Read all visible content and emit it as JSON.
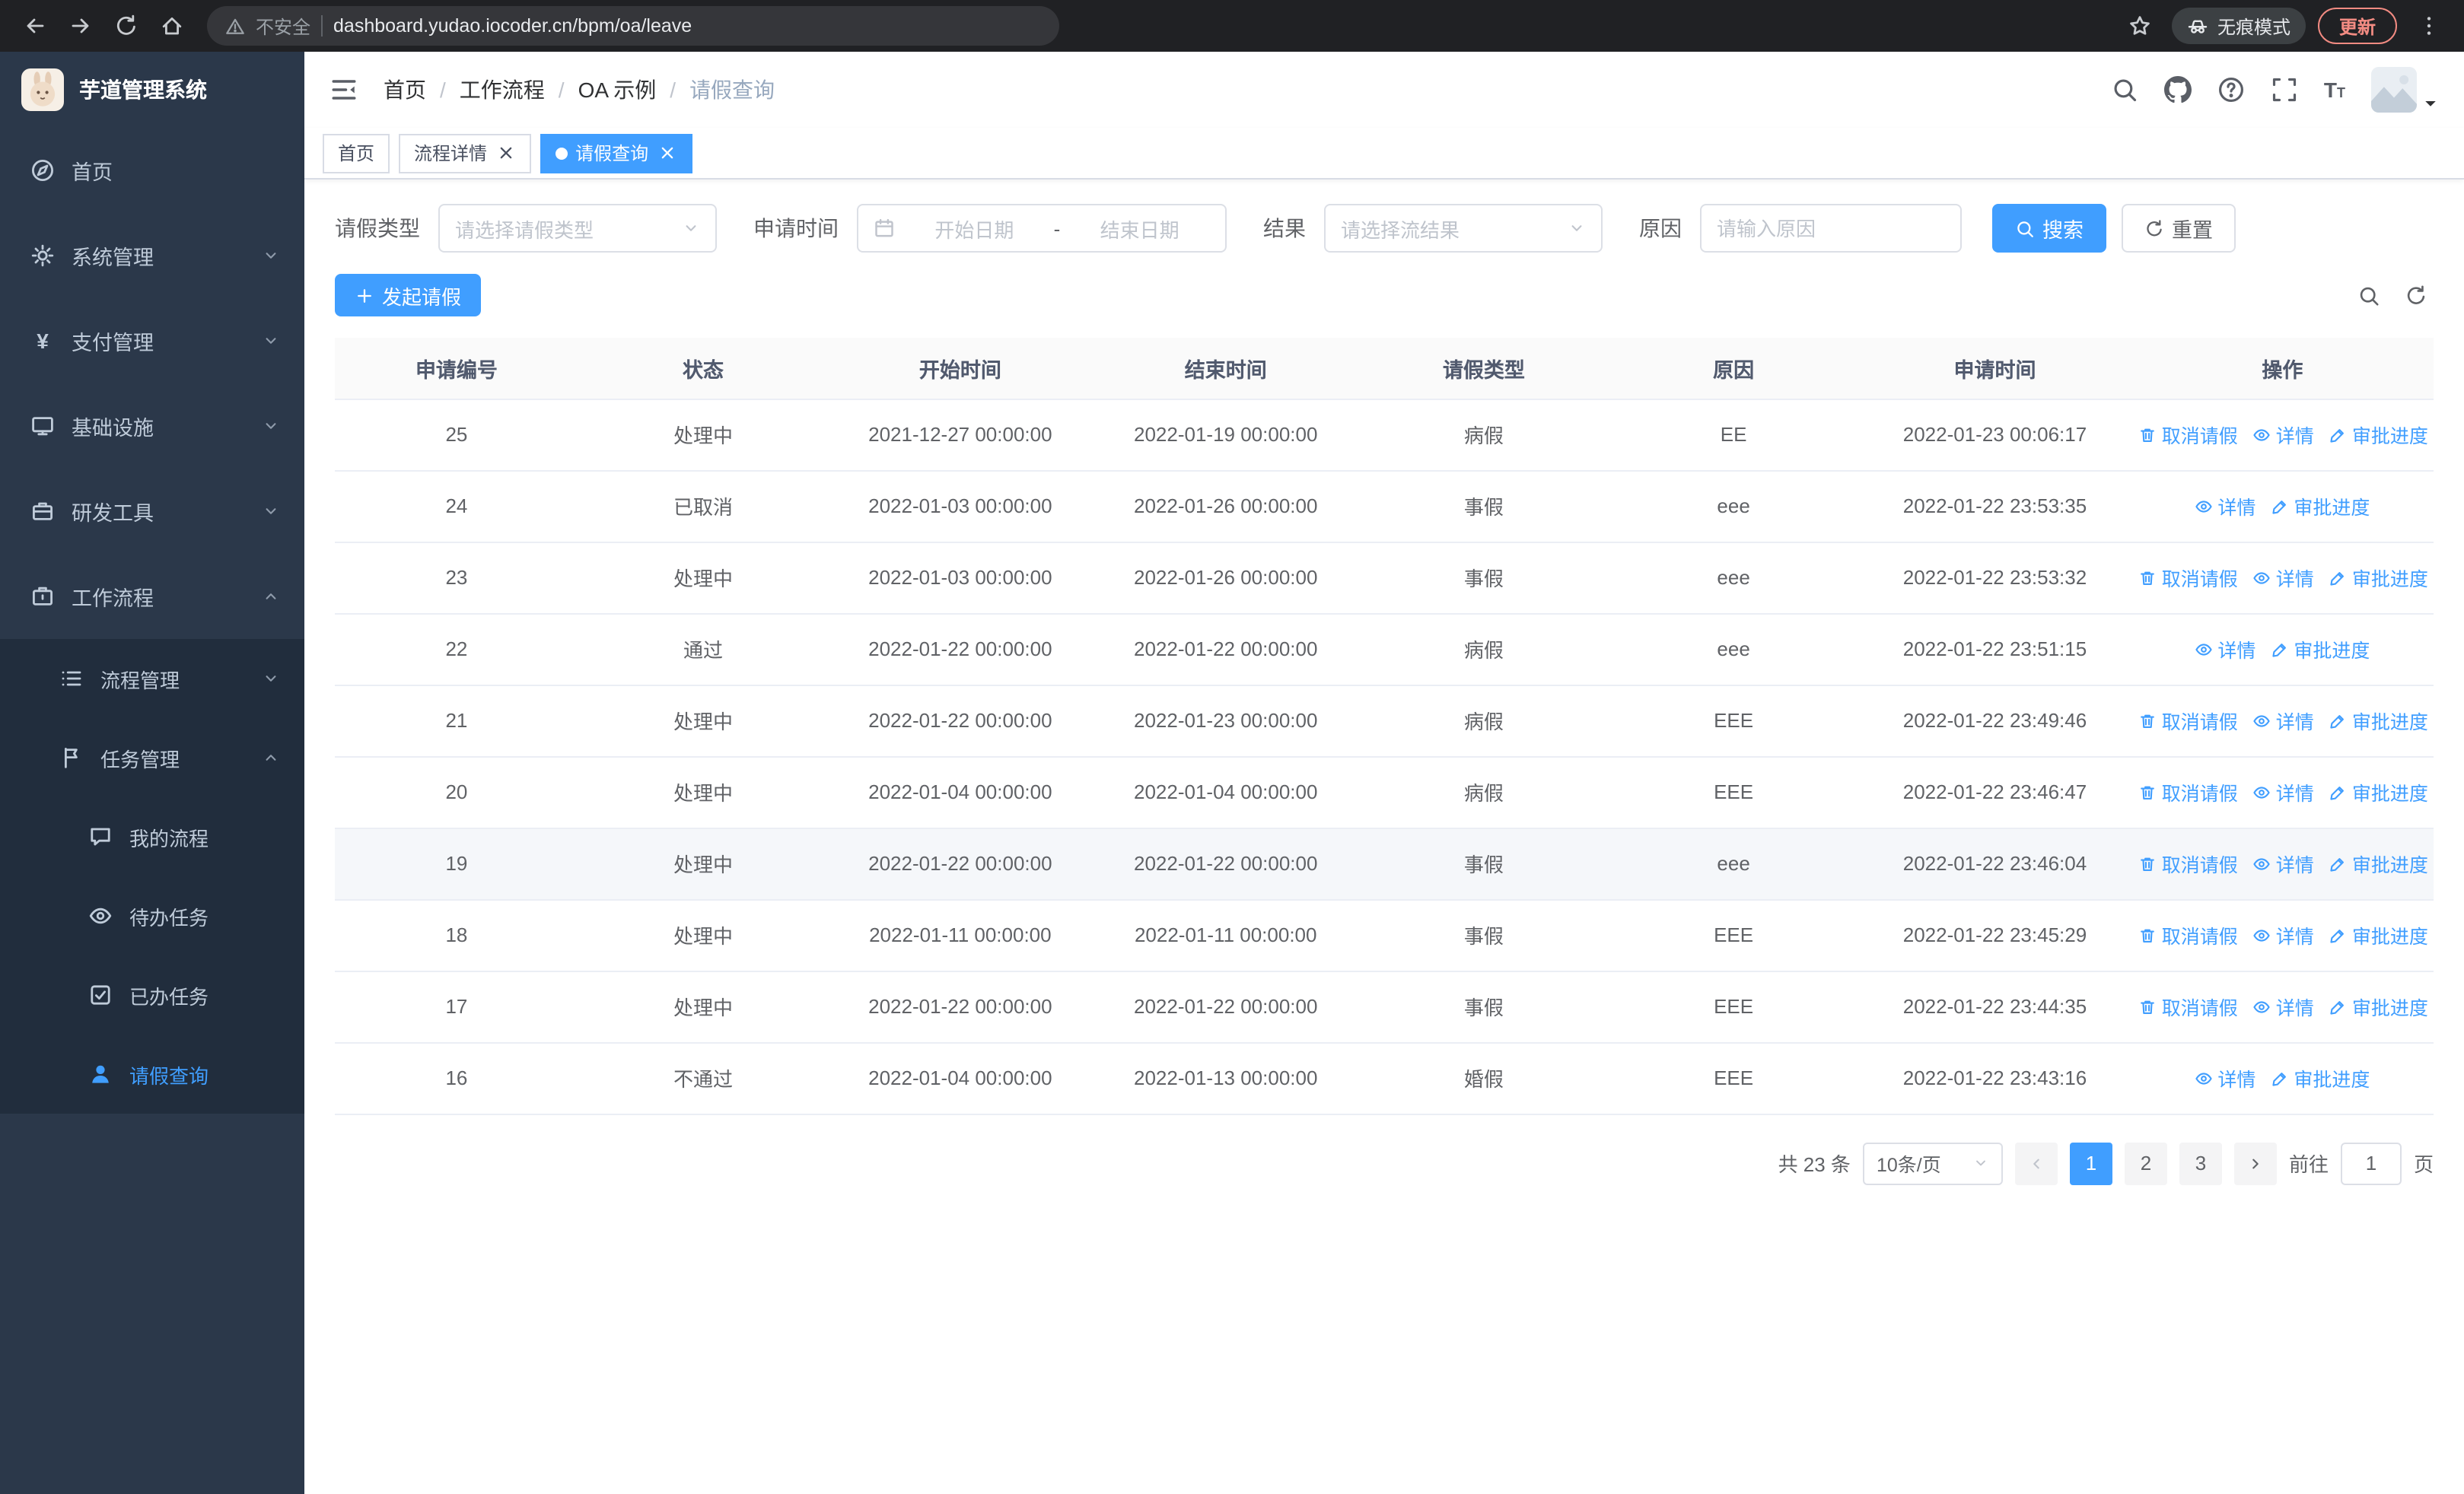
{
  "colors": {
    "accent": "#409eff",
    "sidebar_bg": "#2b384a",
    "sidebar_sub_bg": "#212d3d"
  },
  "browser": {
    "security_label": "不安全",
    "url": "dashboard.yudao.iocoder.cn/bpm/oa/leave",
    "incognito_label": "无痕模式",
    "update_label": "更新"
  },
  "sidebar": {
    "logo_title": "芋道管理系统",
    "items": [
      {
        "key": "home",
        "label": "首页",
        "icon": "guide-icon"
      },
      {
        "key": "system-mgmt",
        "label": "系统管理",
        "icon": "gear-icon",
        "children": [],
        "expanded": false
      },
      {
        "key": "payment-mgmt",
        "label": "支付管理",
        "icon": "yen-icon",
        "children": [],
        "expanded": false
      },
      {
        "key": "infrastructure",
        "label": "基础设施",
        "icon": "monitor-icon",
        "children": [],
        "expanded": false
      },
      {
        "key": "dev-tools",
        "label": "研发工具",
        "icon": "tool-icon",
        "children": [],
        "expanded": false
      },
      {
        "key": "workflow",
        "label": "工作流程",
        "icon": "workflow-icon",
        "expanded": true,
        "children": [
          {
            "key": "process-mgmt",
            "label": "流程管理",
            "icon": "list-icon",
            "children": [],
            "expanded": false
          },
          {
            "key": "task-mgmt",
            "label": "任务管理",
            "icon": "flag-icon",
            "expanded": true,
            "children": [
              {
                "key": "my-process",
                "label": "我的流程",
                "icon": "message-icon"
              },
              {
                "key": "todo-tasks",
                "label": "待办任务",
                "icon": "eye-icon"
              },
              {
                "key": "done-tasks",
                "label": "已办任务",
                "icon": "done-icon"
              },
              {
                "key": "leave-query",
                "label": "请假查询",
                "icon": "user-icon",
                "active": true
              }
            ]
          }
        ]
      }
    ]
  },
  "header": {
    "breadcrumb": [
      "首页",
      "工作流程",
      "OA 示例",
      "请假查询"
    ],
    "separator": "/"
  },
  "tabs": [
    {
      "key": "home",
      "label": "首页",
      "closable": false,
      "active": false
    },
    {
      "key": "process-detail",
      "label": "流程详情",
      "closable": true,
      "active": false
    },
    {
      "key": "leave-query",
      "label": "请假查询",
      "closable": true,
      "active": true
    }
  ],
  "filters": {
    "type_label": "请假类型",
    "type_placeholder": "请选择请假类型",
    "time_label": "申请时间",
    "start_placeholder": "开始日期",
    "separator": "-",
    "end_placeholder": "结束日期",
    "result_label": "结果",
    "result_placeholder": "请选择流结果",
    "reason_label": "原因",
    "reason_placeholder": "请输入原因",
    "search_label": "搜索",
    "reset_label": "重置"
  },
  "toolbar": {
    "create_label": "发起请假"
  },
  "table": {
    "columns": [
      "申请编号",
      "状态",
      "开始时间",
      "结束时间",
      "请假类型",
      "原因",
      "申请时间",
      "操作"
    ],
    "action_labels": {
      "cancel": "取消请假",
      "detail": "详情",
      "progress": "审批进度"
    },
    "rows": [
      {
        "id": "25",
        "status": "处理中",
        "start": "2021-12-27 00:00:00",
        "end": "2022-01-19 00:00:00",
        "type": "病假",
        "reason": "EE",
        "apply_time": "2022-01-23 00:06:17",
        "actions": [
          "cancel",
          "detail",
          "progress"
        ],
        "highlight": false
      },
      {
        "id": "24",
        "status": "已取消",
        "start": "2022-01-03 00:00:00",
        "end": "2022-01-26 00:00:00",
        "type": "事假",
        "reason": "eee",
        "apply_time": "2022-01-22 23:53:35",
        "actions": [
          "detail",
          "progress"
        ],
        "highlight": false
      },
      {
        "id": "23",
        "status": "处理中",
        "start": "2022-01-03 00:00:00",
        "end": "2022-01-26 00:00:00",
        "type": "事假",
        "reason": "eee",
        "apply_time": "2022-01-22 23:53:32",
        "actions": [
          "cancel",
          "detail",
          "progress"
        ],
        "highlight": false
      },
      {
        "id": "22",
        "status": "通过",
        "start": "2022-01-22 00:00:00",
        "end": "2022-01-22 00:00:00",
        "type": "病假",
        "reason": "eee",
        "apply_time": "2022-01-22 23:51:15",
        "actions": [
          "detail",
          "progress"
        ],
        "highlight": false
      },
      {
        "id": "21",
        "status": "处理中",
        "start": "2022-01-22 00:00:00",
        "end": "2022-01-23 00:00:00",
        "type": "病假",
        "reason": "EEE",
        "apply_time": "2022-01-22 23:49:46",
        "actions": [
          "cancel",
          "detail",
          "progress"
        ],
        "highlight": false
      },
      {
        "id": "20",
        "status": "处理中",
        "start": "2022-01-04 00:00:00",
        "end": "2022-01-04 00:00:00",
        "type": "病假",
        "reason": "EEE",
        "apply_time": "2022-01-22 23:46:47",
        "actions": [
          "cancel",
          "detail",
          "progress"
        ],
        "highlight": false
      },
      {
        "id": "19",
        "status": "处理中",
        "start": "2022-01-22 00:00:00",
        "end": "2022-01-22 00:00:00",
        "type": "事假",
        "reason": "eee",
        "apply_time": "2022-01-22 23:46:04",
        "actions": [
          "cancel",
          "detail",
          "progress"
        ],
        "highlight": true
      },
      {
        "id": "18",
        "status": "处理中",
        "start": "2022-01-11 00:00:00",
        "end": "2022-01-11 00:00:00",
        "type": "事假",
        "reason": "EEE",
        "apply_time": "2022-01-22 23:45:29",
        "actions": [
          "cancel",
          "detail",
          "progress"
        ],
        "highlight": false
      },
      {
        "id": "17",
        "status": "处理中",
        "start": "2022-01-22 00:00:00",
        "end": "2022-01-22 00:00:00",
        "type": "事假",
        "reason": "EEE",
        "apply_time": "2022-01-22 23:44:35",
        "actions": [
          "cancel",
          "detail",
          "progress"
        ],
        "highlight": false
      },
      {
        "id": "16",
        "status": "不通过",
        "start": "2022-01-04 00:00:00",
        "end": "2022-01-13 00:00:00",
        "type": "婚假",
        "reason": "EEE",
        "apply_time": "2022-01-22 23:43:16",
        "actions": [
          "detail",
          "progress"
        ],
        "highlight": false
      }
    ]
  },
  "pagination": {
    "total_label": "共 23 条",
    "page_size": "10条/页",
    "pages": [
      "1",
      "2",
      "3"
    ],
    "active_page": "1",
    "goto_label": "前往",
    "goto_value": "1",
    "page_label": "页"
  }
}
